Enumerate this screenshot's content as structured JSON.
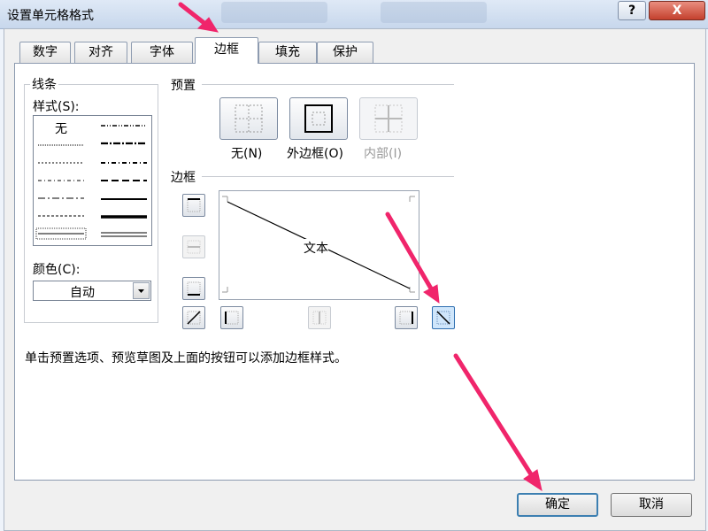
{
  "window": {
    "title": "设置单元格格式",
    "help": "?",
    "close": "X"
  },
  "tabs": [
    {
      "label": "数字"
    },
    {
      "label": "对齐"
    },
    {
      "label": "字体"
    },
    {
      "label": "边框"
    },
    {
      "label": "填充"
    },
    {
      "label": "保护"
    }
  ],
  "active_tab": "边框",
  "line": {
    "group_label": "线条",
    "style_label": "样式(S):",
    "none_label": "无",
    "color_label": "颜色(C):",
    "color_value": "自动"
  },
  "presets": {
    "group_label": "预置",
    "items": [
      {
        "label": "无(N)",
        "enabled": true
      },
      {
        "label": "外边框(O)",
        "enabled": true
      },
      {
        "label": "内部(I)",
        "enabled": false
      }
    ]
  },
  "border": {
    "group_label": "边框",
    "preview_text": "文本",
    "diagonal_down_selected": true
  },
  "hint": "单击预置选项、预览草图及上面的按钮可以添加边框样式。",
  "buttons": {
    "ok": "确定",
    "cancel": "取消"
  },
  "colors": {
    "annotation_arrow": "#f0256b",
    "selected_button": "#cfe6fb"
  }
}
